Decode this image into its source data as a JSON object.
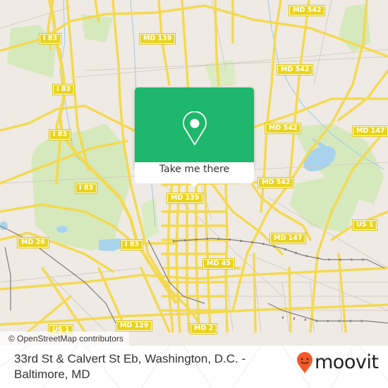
{
  "map": {
    "colors": {
      "land": "#efeae4",
      "road": "#f6e05a",
      "park": "#cfe6b0",
      "water": "#a9d3ec",
      "rail": "#7d7d7d",
      "shield_bg": "#e9d31a"
    },
    "road_shields": [
      {
        "id": "md-542-top",
        "label": "MD 542"
      },
      {
        "id": "i83-a",
        "label": "I 83"
      },
      {
        "id": "md-139-top",
        "label": "MD 139"
      },
      {
        "id": "i83-b",
        "label": "I 83"
      },
      {
        "id": "md-542-mid",
        "label": "MD 542"
      },
      {
        "id": "i83-c",
        "label": "I 83"
      },
      {
        "id": "md-542-right",
        "label": "MD 542"
      },
      {
        "id": "md-147-right",
        "label": "MD 147"
      },
      {
        "id": "i83-d",
        "label": "I 83"
      },
      {
        "id": "md-542-lower",
        "label": "MD 542"
      },
      {
        "id": "md-139-lower",
        "label": "MD 139"
      },
      {
        "id": "us-1-right",
        "label": "US 1"
      },
      {
        "id": "md-26",
        "label": "MD 26"
      },
      {
        "id": "md-147-lower",
        "label": "MD 147"
      },
      {
        "id": "i83-e",
        "label": "I 83"
      },
      {
        "id": "md-45",
        "label": "MD 45"
      },
      {
        "id": "us-1-left",
        "label": "US 1"
      },
      {
        "id": "md-129",
        "label": "MD 129"
      },
      {
        "id": "md-2",
        "label": "MD 2"
      }
    ],
    "attribution": "© OpenStreetMap contributors",
    "popup": {
      "button_label": "Take me there",
      "icon": "map-pin-icon",
      "color": "#1fb76b"
    }
  },
  "footer": {
    "address": "33rd St & Calvert St Eb, Washington, D.C. - Baltimore, MD",
    "brand": "moovit",
    "brand_icon": "moovit-logo-pin-icon",
    "brand_color": "#f15a29"
  }
}
